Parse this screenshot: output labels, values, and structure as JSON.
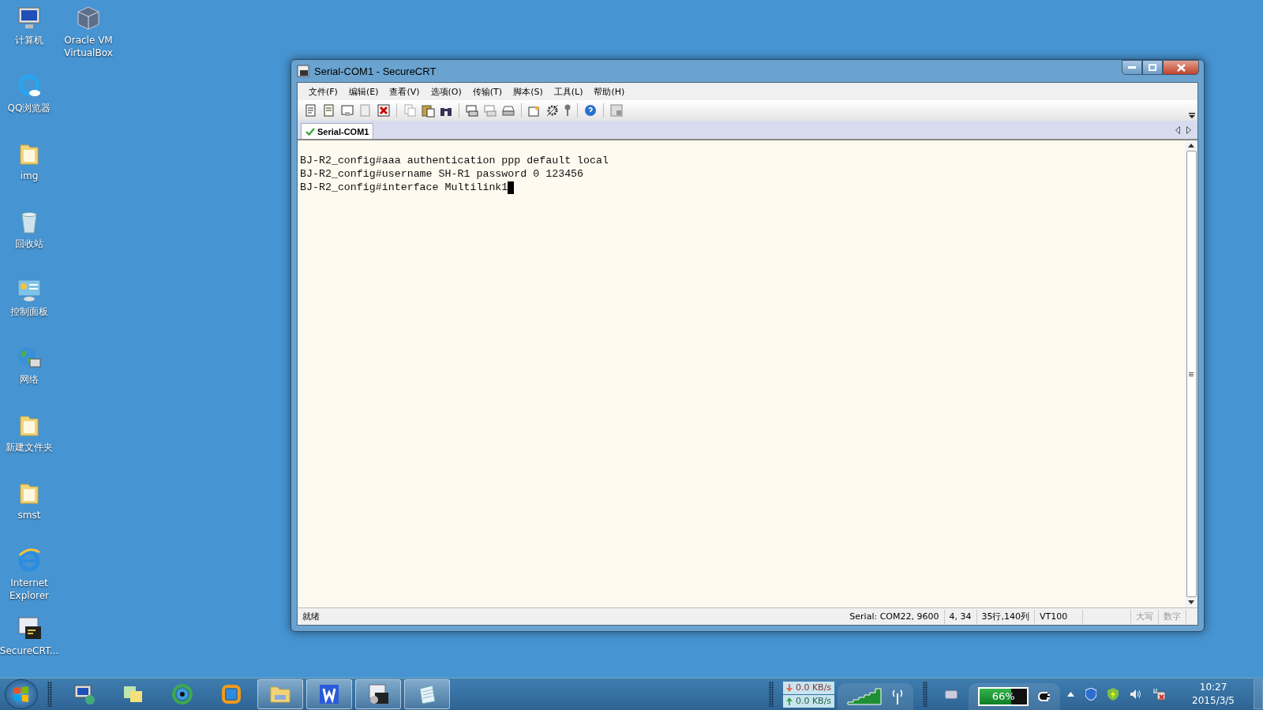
{
  "desktop_icons": [
    {
      "kind": "computer",
      "label": "计算机"
    },
    {
      "kind": "virtualbox",
      "label": "Oracle VM VirtualBox"
    },
    {
      "kind": "browser",
      "label": "QQ浏览器"
    },
    {
      "kind": "folder",
      "label": "img"
    },
    {
      "kind": "recycle",
      "label": "回收站"
    },
    {
      "kind": "control",
      "label": "控制面板"
    },
    {
      "kind": "network",
      "label": "网络"
    },
    {
      "kind": "folder",
      "label": "新建文件夹"
    },
    {
      "kind": "folder",
      "label": "smst"
    },
    {
      "kind": "ie",
      "label": "Internet Explorer"
    },
    {
      "kind": "terminal",
      "label": "SecureCRT..."
    }
  ],
  "window": {
    "title": "Serial-COM1 - SecureCRT",
    "menu": [
      "文件(F)",
      "编辑(E)",
      "查看(V)",
      "选项(O)",
      "传输(T)",
      "脚本(S)",
      "工具(L)",
      "帮助(H)"
    ],
    "tabs": [
      {
        "label": "Serial-COM1",
        "selected": true
      }
    ],
    "terminal_lines": [
      "BJ-R2_config#aaa authentication ppp default local",
      "BJ-R2_config#username SH-R1 password 0 123456",
      "BJ-R2_config#interface Multilink1"
    ],
    "status_bar": [
      {
        "text": "就绪",
        "disabled": false
      },
      {
        "text": "Serial: COM22, 9600",
        "disabled": false
      },
      {
        "text": "4,  34",
        "disabled": false
      },
      {
        "text": "35行,140列",
        "disabled": false
      },
      {
        "text": "VT100",
        "disabled": false
      },
      {
        "text": "大写",
        "disabled": true
      },
      {
        "text": "数字",
        "disabled": true
      }
    ]
  },
  "taskbar": {
    "apps": [
      {
        "kind": "remote",
        "running": false
      },
      {
        "kind": "notes",
        "running": false
      },
      {
        "kind": "eye",
        "running": false
      },
      {
        "kind": "square",
        "running": false
      },
      {
        "kind": "folder",
        "running": true
      },
      {
        "kind": "writer",
        "running": true
      },
      {
        "kind": "terminal",
        "running": true
      },
      {
        "kind": "notepad",
        "running": true
      }
    ],
    "download_speed": "0.0 KB/s",
    "upload_speed": "0.0 KB/s",
    "battery": {
      "text": "66%",
      "level": 0.66
    },
    "time": "10:27",
    "date": "2015/3/5"
  }
}
